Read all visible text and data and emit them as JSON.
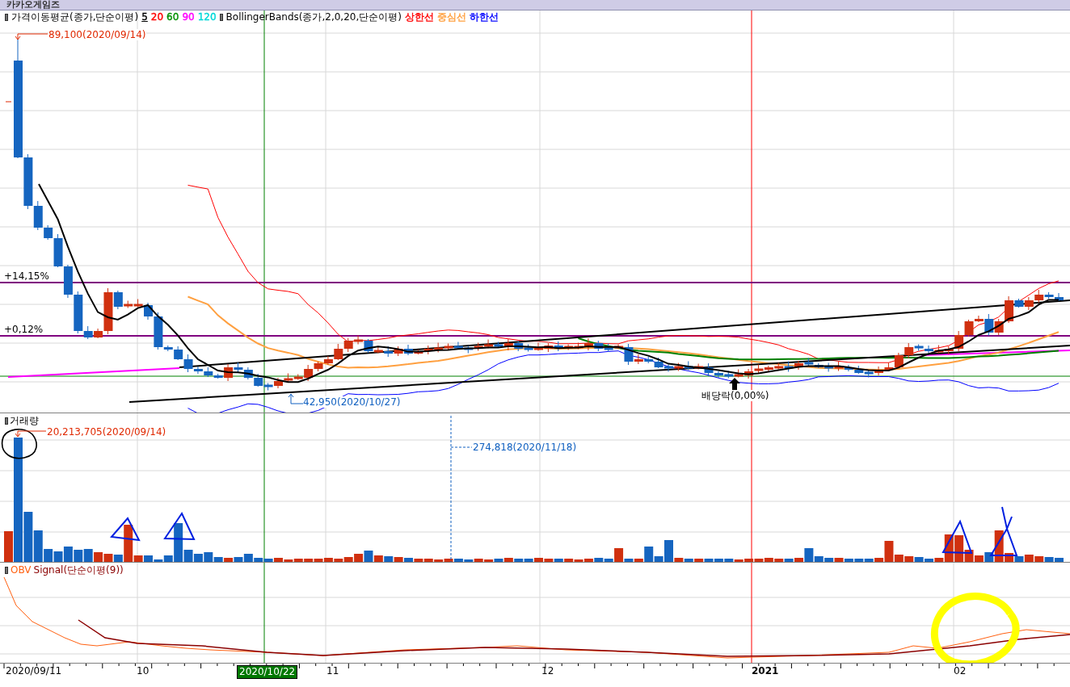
{
  "title": "카카오게임즈",
  "price_panel": {
    "indicators": [
      {
        "name": "가격이동평균(종가,단순이평)",
        "params": [
          {
            "text": "5",
            "color": "#000000",
            "selected": true
          },
          {
            "text": "20",
            "color": "#ff0000",
            "selected": false
          },
          {
            "text": "60",
            "color": "#009000",
            "selected": false
          },
          {
            "text": "90",
            "color": "#ff00ff",
            "selected": false
          },
          {
            "text": "120",
            "color": "#00d8d8",
            "selected": false
          }
        ]
      },
      {
        "name": "BollingerBands(종가,2,0,20,단순이평)",
        "params": [
          {
            "text": "상한선",
            "color": "#ff0000",
            "selected": false
          },
          {
            "text": "중심선",
            "color": "#ffa040",
            "selected": false
          },
          {
            "text": "하한선",
            "color": "#0000ff",
            "selected": false
          }
        ]
      }
    ],
    "annotations": [
      {
        "kind": "high",
        "text": "89,100(2020/09/14)"
      },
      {
        "kind": "low",
        "text": "42,950(2020/10/27)"
      },
      {
        "kind": "level",
        "text": "+14,15%"
      },
      {
        "kind": "level",
        "text": "+0,12%"
      },
      {
        "kind": "event",
        "text": "배당락(0,00%)"
      }
    ]
  },
  "volume_panel": {
    "name": "거래량",
    "annotations": [
      {
        "kind": "high",
        "text": "20,213,705(2020/09/14)"
      },
      {
        "kind": "low",
        "text": "274,818(2020/11/18)"
      }
    ]
  },
  "obv_panel": {
    "series": [
      {
        "name": "OBV",
        "color": "#ff6010"
      },
      {
        "name": "Signal(단순이평(9))",
        "color": "#8b0000"
      }
    ]
  },
  "x_axis": {
    "labels": [
      {
        "kind": "date",
        "text": "2020/09/11",
        "selected": false
      },
      {
        "kind": "month",
        "text": "10",
        "selected": false
      },
      {
        "kind": "date",
        "text": "2020/10/22",
        "selected": true
      },
      {
        "kind": "month",
        "text": "11",
        "selected": false
      },
      {
        "kind": "month",
        "text": "12",
        "selected": false
      },
      {
        "kind": "year",
        "text": "2021",
        "selected": false
      },
      {
        "kind": "month",
        "text": "02",
        "selected": false
      }
    ]
  }
}
